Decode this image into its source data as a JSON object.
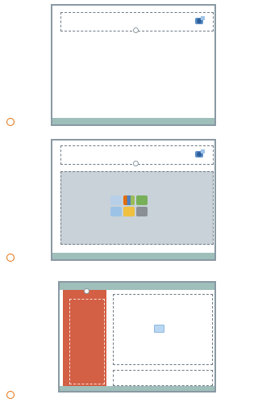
{
  "layouts": [
    {
      "id": "title-only",
      "selected": false
    },
    {
      "id": "title-and-content",
      "selected": false
    },
    {
      "id": "picture-with-caption",
      "selected": false
    }
  ],
  "icons": {
    "corner": "layout-corner-icon",
    "content": "insert-content-icons",
    "picture": "insert-picture-icon"
  },
  "colors": {
    "radio_border": "#e46c0a",
    "thumb_border": "#8a99a3",
    "bar": "#9fbfba",
    "content_area": "#c8d2d8",
    "accent_panel": "#d35f44"
  }
}
